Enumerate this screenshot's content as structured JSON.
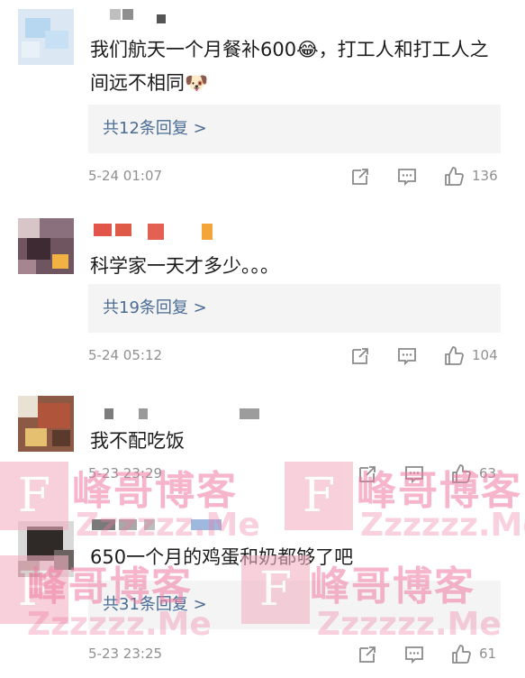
{
  "comments": [
    {
      "text": "我们航天一个月餐补600😂，打工人和打工人之间远不相同🐶",
      "reply_label": "共12条回复 >",
      "time": "5-24 01:07",
      "likes": "136"
    },
    {
      "text": "科学家一天才多少。。。",
      "reply_label": "共19条回复 >",
      "time": "5-24 05:12",
      "likes": "104"
    },
    {
      "text": "我不配吃饭",
      "reply_label": "",
      "time": "5-23 23:29",
      "likes": "63"
    },
    {
      "text": "650一个月的鸡蛋和奶都够了吧",
      "reply_label": "共31条回复 >",
      "time": "5-23 23:25",
      "likes": "61"
    }
  ],
  "icons": {
    "share": "share-icon",
    "comment": "comment-icon",
    "like": "thumbs-up-icon"
  },
  "watermark": {
    "logo_letter": "F",
    "site_name": "峰哥博客",
    "url": "Zzzzzz.Me"
  },
  "colors": {
    "reply_link": "#4a6c95",
    "meta_text": "#909090",
    "reply_bg": "#f4f4f4",
    "watermark": "#f07aa0"
  }
}
